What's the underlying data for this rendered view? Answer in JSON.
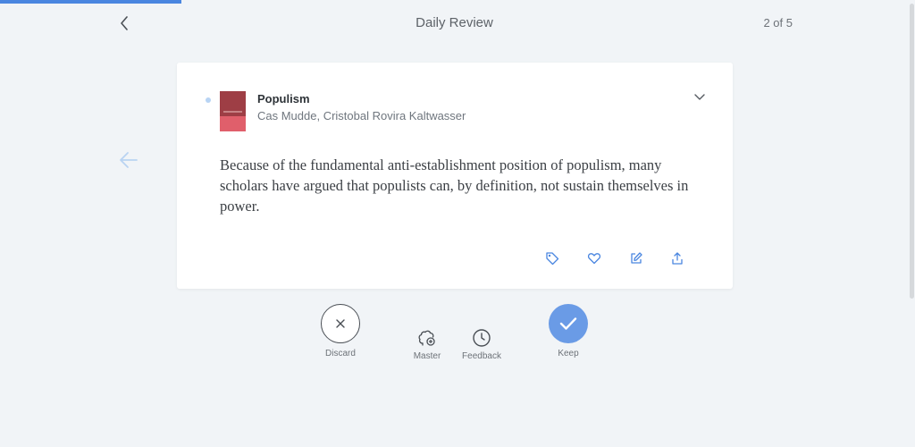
{
  "review": {
    "progress_fraction": 0.2,
    "title": "Daily Review",
    "counter": "2 of 5"
  },
  "highlight": {
    "book_title": "Populism",
    "book_author": "Cas Mudde, Cristobal Rovira Kaltwasser",
    "text": "Because of the fundamental anti-establishment position of populism, many scholars have argued that populists can, by definition, not sustain themselves in power.",
    "actions": [
      "tag-icon",
      "heart-icon",
      "edit-icon",
      "share-icon"
    ]
  },
  "controls": {
    "discard_label": "Discard",
    "master_label": "Master",
    "feedback_label": "Feedback",
    "keep_label": "Keep"
  },
  "colors": {
    "accent": "#4a86e0",
    "keep_button": "#6a9be6",
    "background": "#f1f4f7"
  }
}
